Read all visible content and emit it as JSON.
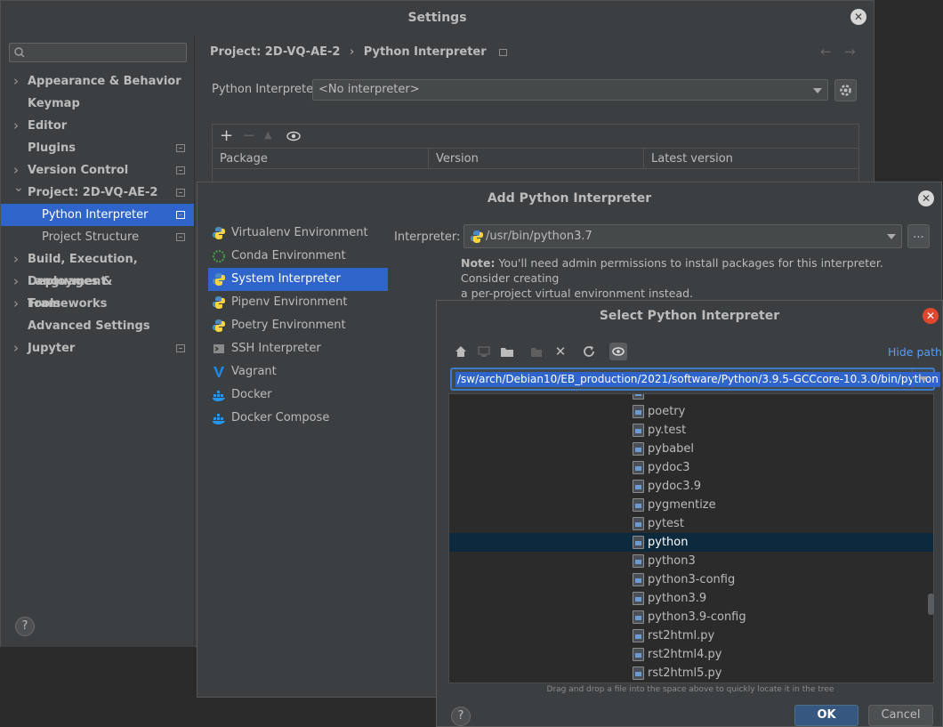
{
  "settings": {
    "title": "Settings",
    "search_placeholder": "",
    "breadcrumb_project": "Project: 2D-VQ-AE-2",
    "breadcrumb_sep": "›",
    "breadcrumb_page": "Python Interpreter",
    "back_arrow": "←",
    "forward_arrow": "→",
    "sidebar": [
      {
        "label": "Appearance & Behavior",
        "expandable": true
      },
      {
        "label": "Keymap",
        "expandable": false
      },
      {
        "label": "Editor",
        "expandable": true
      },
      {
        "label": "Plugins",
        "expandable": false
      },
      {
        "label": "Version Control",
        "expandable": true
      },
      {
        "label": "Project: 2D-VQ-AE-2",
        "expandable": true
      },
      {
        "label": "Python Interpreter",
        "expandable": false
      },
      {
        "label": "Project Structure",
        "expandable": false
      },
      {
        "label": "Build, Execution, Deployment",
        "expandable": true
      },
      {
        "label": "Languages & Frameworks",
        "expandable": true
      },
      {
        "label": "Tools",
        "expandable": true
      },
      {
        "label": "Advanced Settings",
        "expandable": false
      },
      {
        "label": "Jupyter",
        "expandable": true
      }
    ],
    "interpreter_label": "Python Interpreter:",
    "interpreter_value": "<No interpreter>",
    "package_columns": [
      "Package",
      "Version",
      "Latest version"
    ],
    "help": "?"
  },
  "add_dialog": {
    "title": "Add Python Interpreter",
    "environments": [
      {
        "label": "Virtualenv Environment",
        "icon": "virtualenv-icon"
      },
      {
        "label": "Conda Environment",
        "icon": "conda-icon"
      },
      {
        "label": "System Interpreter",
        "icon": "python-icon"
      },
      {
        "label": "Pipenv Environment",
        "icon": "pipenv-icon"
      },
      {
        "label": "Poetry Environment",
        "icon": "poetry-icon"
      },
      {
        "label": "SSH Interpreter",
        "icon": "ssh-icon"
      },
      {
        "label": "Vagrant",
        "icon": "vagrant-icon"
      },
      {
        "label": "Docker",
        "icon": "docker-icon"
      },
      {
        "label": "Docker Compose",
        "icon": "docker-compose-icon"
      }
    ],
    "interpreter_label": "Interpreter:",
    "interpreter_value": "/usr/bin/python3.7",
    "browse_label": "...",
    "note_bold": "Note:",
    "note_line1": "You'll need admin permissions to install packages for this interpreter. Consider creating",
    "note_line2": "a per-project virtual environment instead."
  },
  "select_dialog": {
    "title": "Select Python Interpreter",
    "hide_path": "Hide path",
    "path": "/sw/arch/Debian10/EB_production/2021/software/Python/3.9.5-GCCcore-10.3.0/bin/python",
    "files": [
      "poetry",
      "py.test",
      "pybabel",
      "pydoc3",
      "pydoc3.9",
      "pygmentize",
      "pytest",
      "python",
      "python3",
      "python3-config",
      "python3.9",
      "python3.9-config",
      "rst2html.py",
      "rst2html4.py",
      "rst2html5.py"
    ],
    "selected_file": "python",
    "hint": "Drag and drop a file into the space above to quickly locate it in the tree",
    "ok": "OK",
    "cancel": "Cancel",
    "help": "?"
  },
  "colors": {
    "accent": "#2f65ca",
    "link": "#589df6",
    "ok_button": "#365880",
    "selection_row": "#0d293e"
  }
}
